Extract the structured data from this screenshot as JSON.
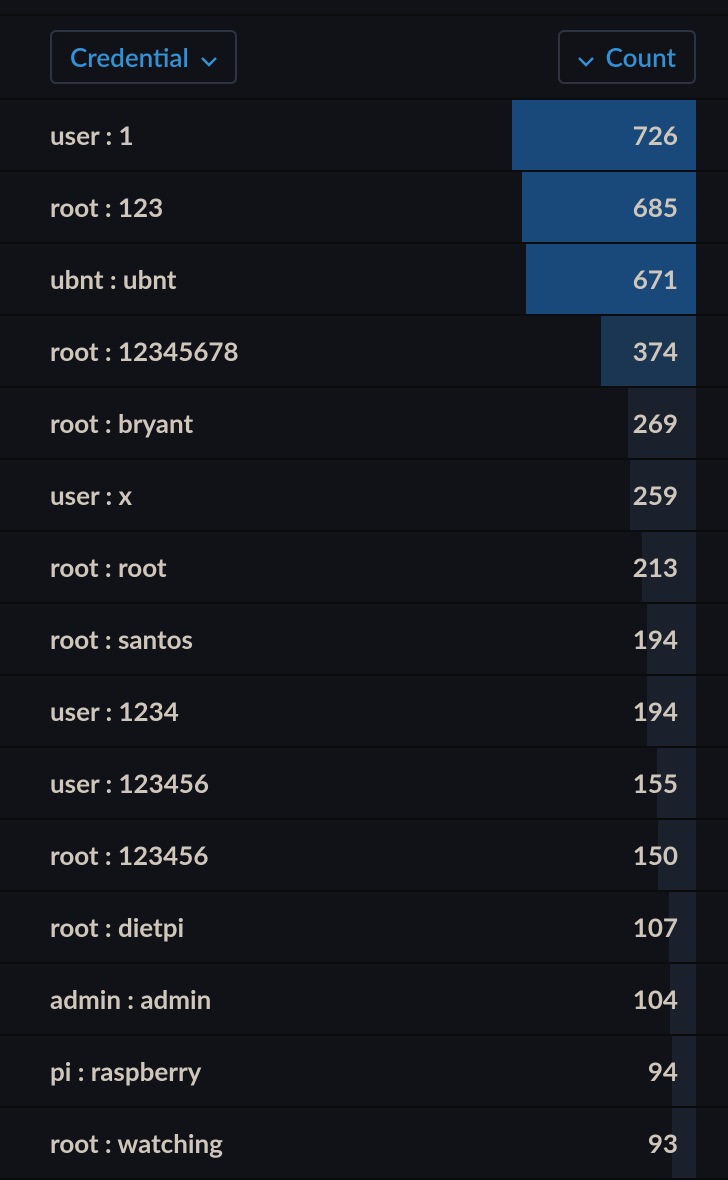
{
  "header": {
    "credential_label": "Credential",
    "count_label": "Count"
  },
  "max_count": 726,
  "rows": [
    {
      "credential": "user : 1",
      "count": 726
    },
    {
      "credential": "root : 123",
      "count": 685
    },
    {
      "credential": "ubnt : ubnt",
      "count": 671
    },
    {
      "credential": "root : 12345678",
      "count": 374
    },
    {
      "credential": "root : bryant",
      "count": 269
    },
    {
      "credential": "user : x",
      "count": 259
    },
    {
      "credential": "root : root",
      "count": 213
    },
    {
      "credential": "root : santos",
      "count": 194
    },
    {
      "credential": "user : 1234",
      "count": 194
    },
    {
      "credential": "user : 123456",
      "count": 155
    },
    {
      "credential": "root : 123456",
      "count": 150
    },
    {
      "credential": "root : dietpi",
      "count": 107
    },
    {
      "credential": "admin : admin",
      "count": 104
    },
    {
      "credential": "pi : raspberry",
      "count": 94
    },
    {
      "credential": "root : watching",
      "count": 93
    }
  ],
  "chart_data": {
    "type": "bar",
    "title": "",
    "xlabel": "Count",
    "ylabel": "Credential",
    "categories": [
      "user : 1",
      "root : 123",
      "ubnt : ubnt",
      "root : 12345678",
      "root : bryant",
      "user : x",
      "root : root",
      "root : santos",
      "user : 1234",
      "user : 123456",
      "root : 123456",
      "root : dietpi",
      "admin : admin",
      "pi : raspberry",
      "root : watching"
    ],
    "values": [
      726,
      685,
      671,
      374,
      269,
      259,
      213,
      194,
      194,
      155,
      150,
      107,
      104,
      94,
      93
    ],
    "xlim": [
      0,
      726
    ]
  }
}
